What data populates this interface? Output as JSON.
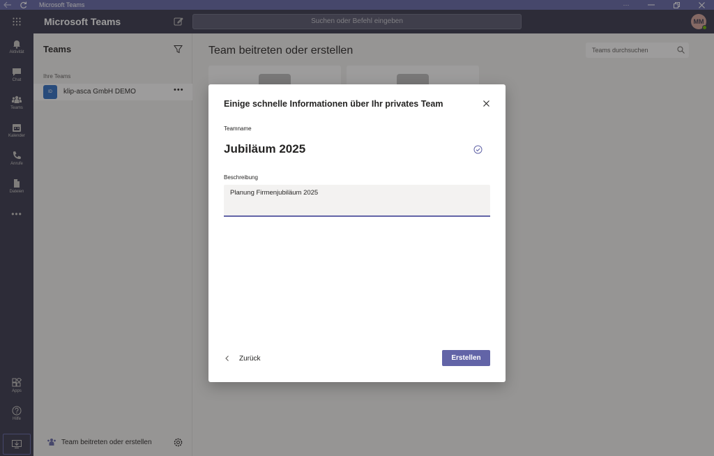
{
  "window": {
    "title": "Microsoft Teams",
    "more_label": "···"
  },
  "header": {
    "app_title": "Microsoft Teams",
    "search_placeholder": "Suchen oder Befehl eingeben",
    "avatar_initials": "MM"
  },
  "rail": {
    "items": [
      {
        "label": "Aktivität",
        "icon": "bell-icon"
      },
      {
        "label": "Chat",
        "icon": "chat-icon"
      },
      {
        "label": "Teams",
        "icon": "teams-icon"
      },
      {
        "label": "Kalender",
        "icon": "calendar-icon"
      },
      {
        "label": "Anrufe",
        "icon": "phone-icon"
      },
      {
        "label": "Dateien",
        "icon": "file-icon"
      }
    ],
    "more_label": "•••",
    "apps_label": "Apps",
    "help_label": "Hilfe"
  },
  "pane": {
    "title": "Teams",
    "section_label": "Ihre Teams",
    "team": {
      "name": "klip-asca GmbH DEMO",
      "tile_initials": "ID",
      "more_label": "•••"
    },
    "join_label": "Team beitreten oder erstellen"
  },
  "main": {
    "title": "Team beitreten oder erstellen",
    "search_placeholder": "Teams durchsuchen"
  },
  "dialog": {
    "title": "Einige schnelle Informationen über Ihr privates Team",
    "teamname_label": "Teamname",
    "teamname_value": "Jubiläum 2025",
    "description_label": "Beschreibung",
    "description_value": "Planung Firmenjubiläum 2025",
    "back_label": "Zurück",
    "create_label": "Erstellen"
  },
  "colors": {
    "brand": "#6264a7",
    "header_bg": "#33344a",
    "presence": "#6bb700"
  }
}
